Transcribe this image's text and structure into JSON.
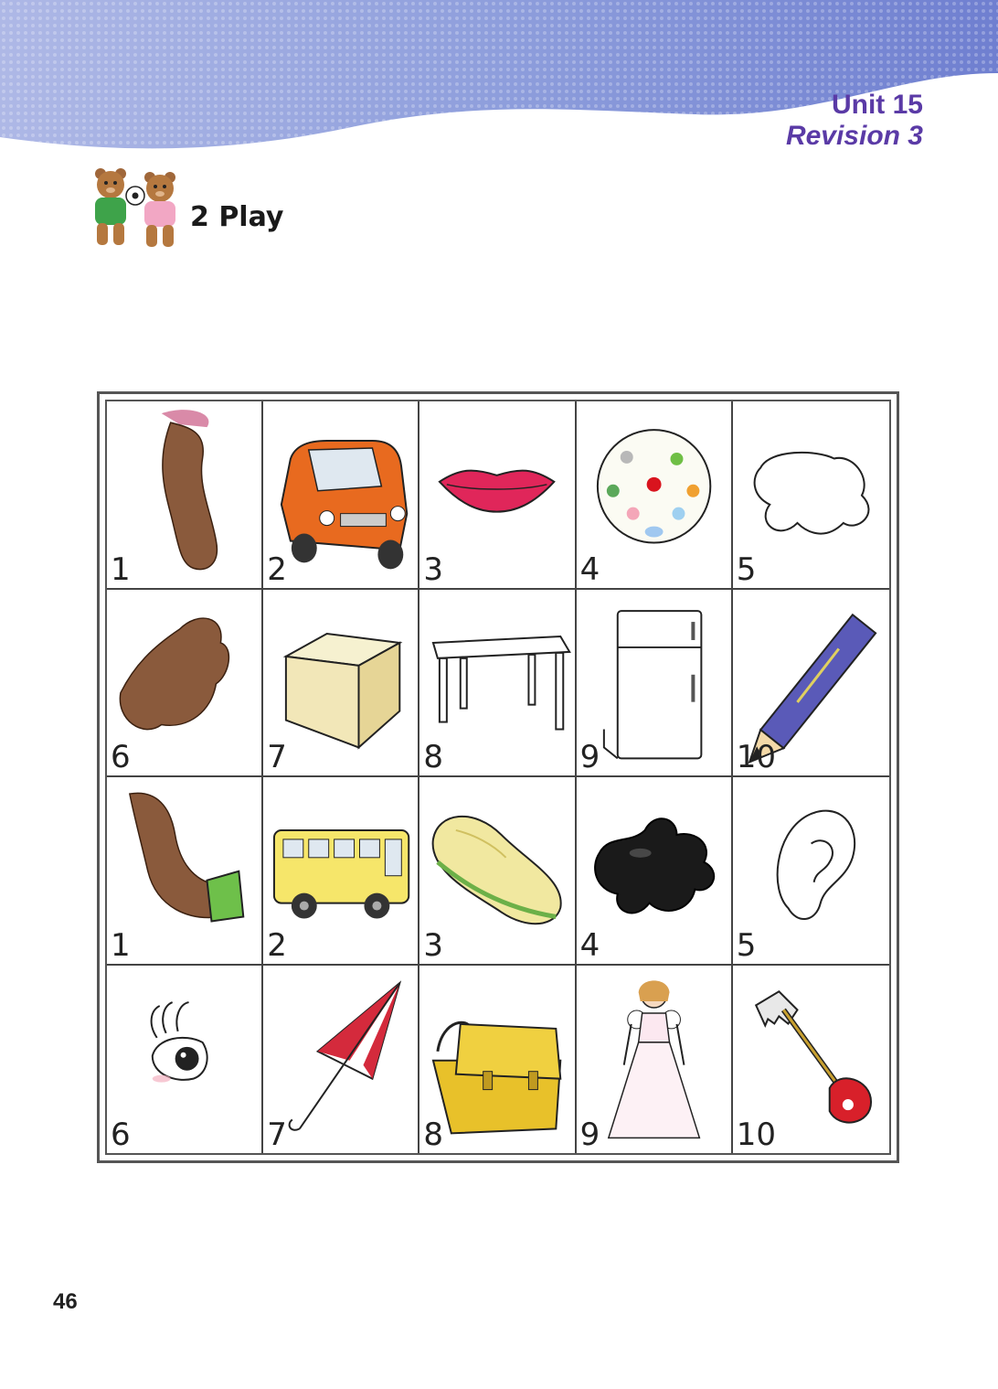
{
  "header": {
    "unit_title": "Unit 15",
    "unit_subtitle": "Revision 3"
  },
  "section": {
    "title": "2 Play",
    "icon": "bears-with-ball-icon"
  },
  "board": {
    "cells": [
      {
        "number": "1",
        "picture": "leg"
      },
      {
        "number": "2",
        "picture": "car"
      },
      {
        "number": "3",
        "picture": "lips"
      },
      {
        "number": "4",
        "picture": "ball"
      },
      {
        "number": "5",
        "picture": "puddle"
      },
      {
        "number": "6",
        "picture": "paw"
      },
      {
        "number": "7",
        "picture": "box"
      },
      {
        "number": "8",
        "picture": "table"
      },
      {
        "number": "9",
        "picture": "fridge"
      },
      {
        "number": "10",
        "picture": "pencil"
      },
      {
        "number": "1",
        "picture": "arm"
      },
      {
        "number": "2",
        "picture": "bus"
      },
      {
        "number": "3",
        "picture": "sandwich"
      },
      {
        "number": "4",
        "picture": "ink-blot"
      },
      {
        "number": "5",
        "picture": "ear"
      },
      {
        "number": "6",
        "picture": "eye"
      },
      {
        "number": "7",
        "picture": "umbrella"
      },
      {
        "number": "8",
        "picture": "bag"
      },
      {
        "number": "9",
        "picture": "doll"
      },
      {
        "number": "10",
        "picture": "key"
      }
    ]
  },
  "colors": {
    "heading": "#5a3aa6",
    "banner": "#8f9fd6"
  },
  "footer": {
    "page_number": "46"
  }
}
